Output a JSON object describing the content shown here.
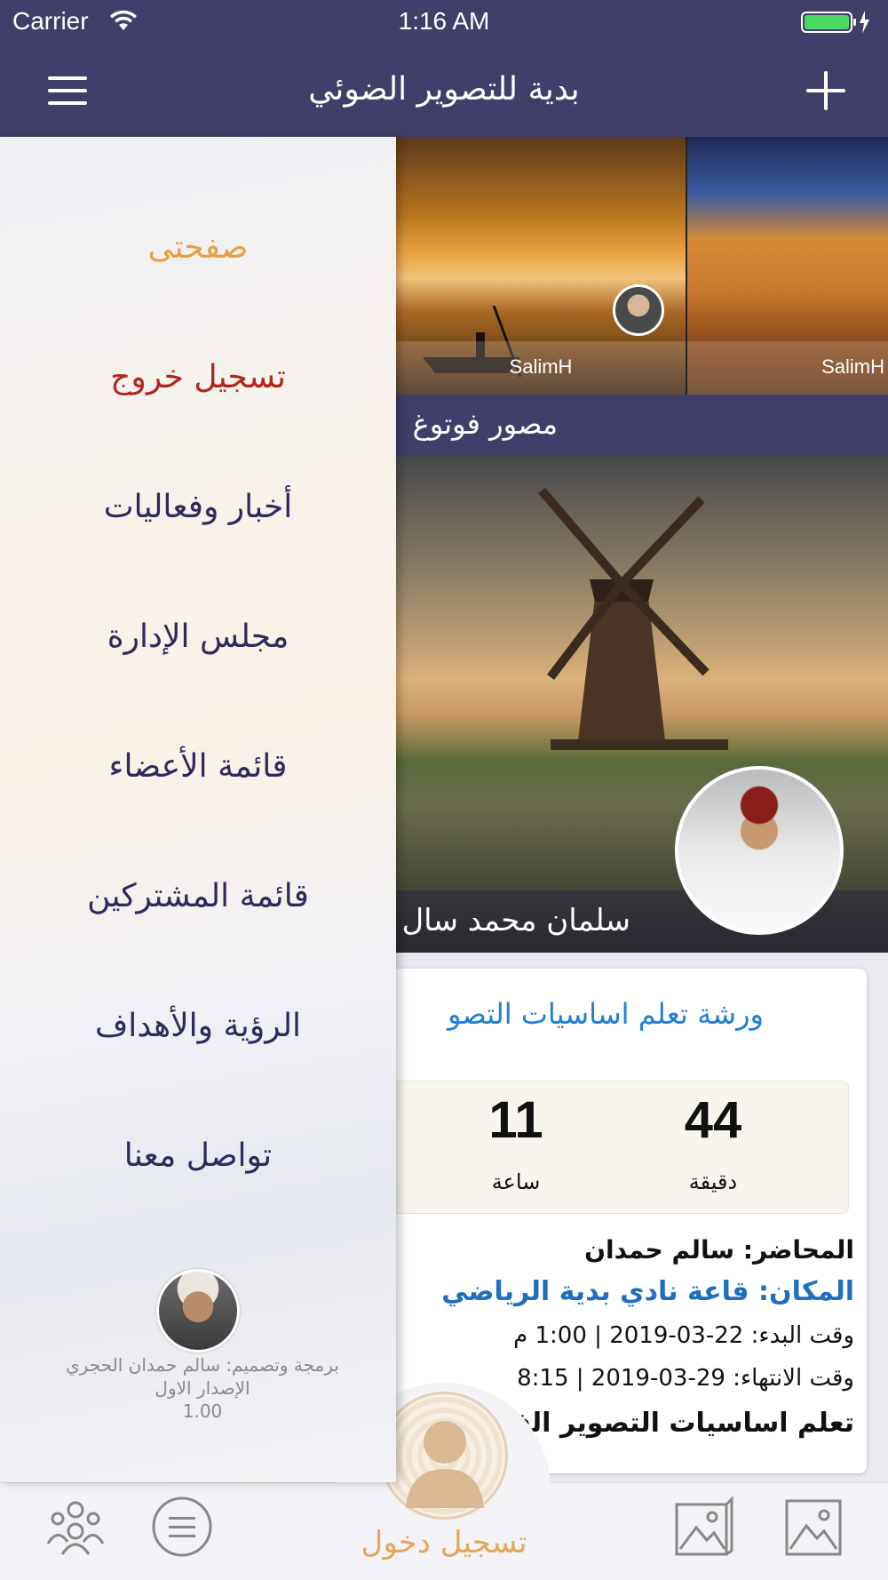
{
  "status_bar": {
    "carrier": "Carrier",
    "time": "1:16 AM"
  },
  "nav": {
    "title": "بدية للتصوير الضوئي"
  },
  "gallery": {
    "photos": [
      {
        "caption": "SalimH"
      },
      {
        "caption": "SalimH"
      }
    ],
    "section_title": "مصور فوتوغ"
  },
  "hero": {
    "name": "سلمان محمد سال"
  },
  "event": {
    "title": "ورشة تعلم اساسيات التصو",
    "countdown": [
      {
        "value": "44",
        "unit": "دقيقة"
      },
      {
        "value": "11",
        "unit": "ساعة"
      }
    ],
    "lecturer": "المحاضر: سالم حمدان",
    "place": "المكان: قاعة نادي بدية الرياضي",
    "start": "وقت البدء: 22-03-2019 | 1:00 م",
    "end": "وقت الانتهاء: 29-03-2019 | 8:15",
    "topic": "تعلم اساسيات التصوير الف"
  },
  "drawer": {
    "items": [
      {
        "label": "صفحتى"
      },
      {
        "label": "تسجيل خروج"
      },
      {
        "label": "أخبار وفعاليات"
      },
      {
        "label": "مجلس الإدارة"
      },
      {
        "label": "قائمة الأعضاء"
      },
      {
        "label": "قائمة المشتركين"
      },
      {
        "label": "الرؤية والأهداف"
      },
      {
        "label": "تواصل معنا"
      }
    ],
    "credit": "برمجة وتصميم: سالم حمدان الحجري",
    "version_label": "الإصدار الاول",
    "version": "1.00"
  },
  "tabbar": {
    "login_label": "تسجيل دخول"
  },
  "colors": {
    "nav_bg": "#413f69",
    "accent_gold": "#e6a040",
    "logout_red": "#b0261c",
    "link_blue": "#1f7fd6"
  }
}
